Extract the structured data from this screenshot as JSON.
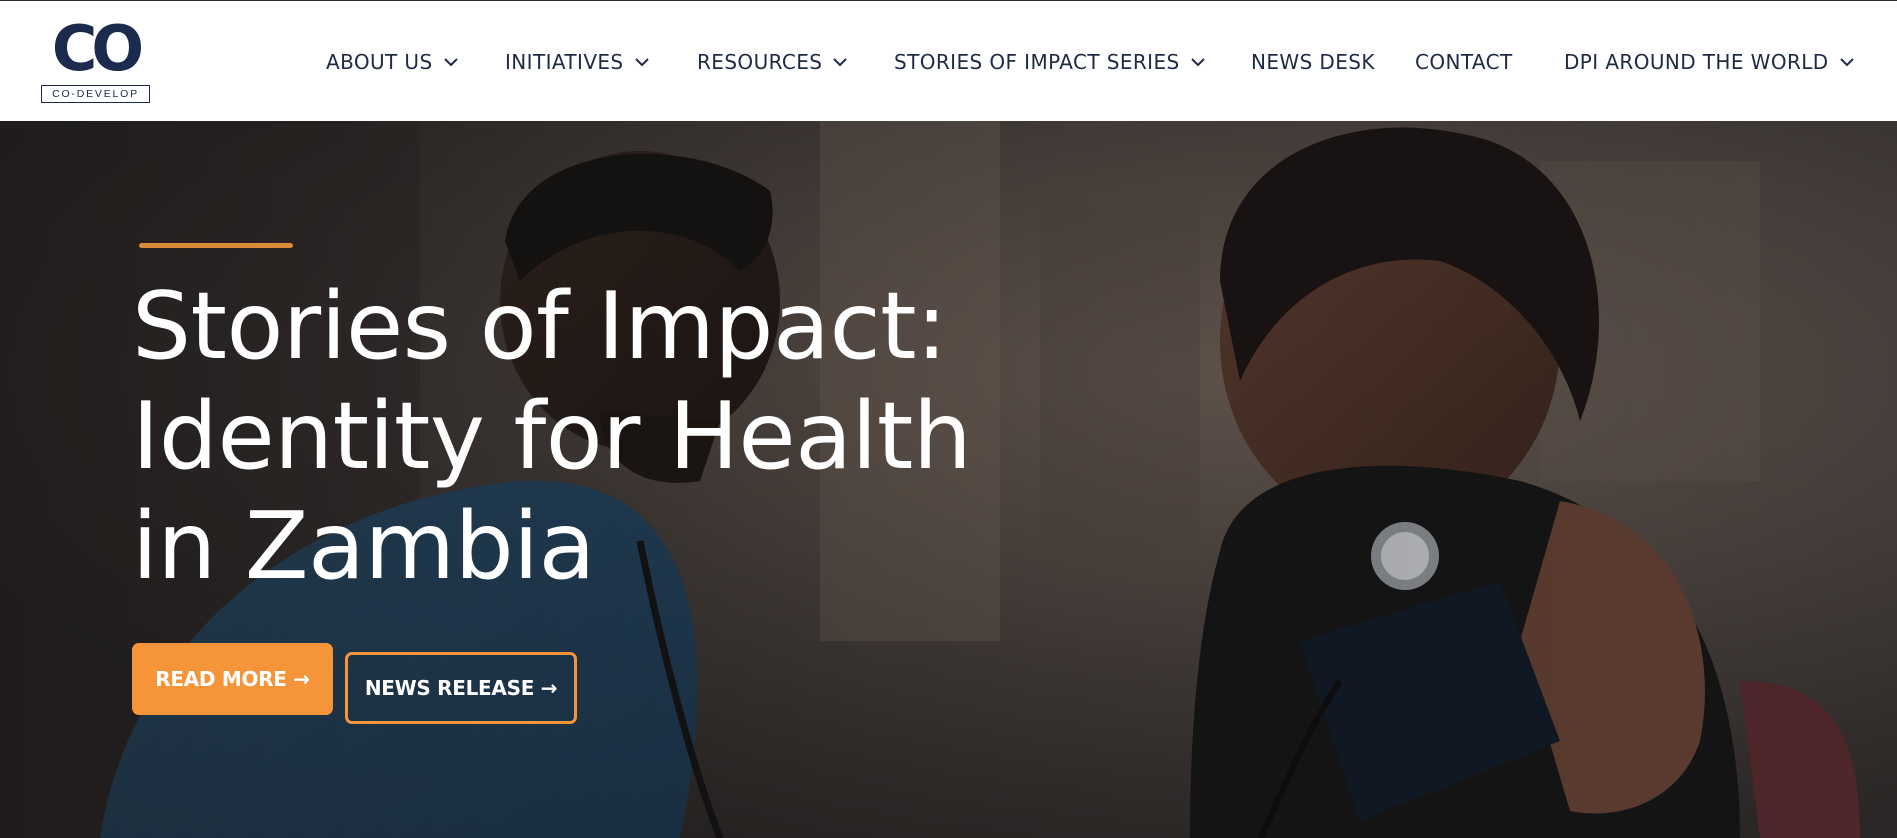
{
  "brand": {
    "logo_mark": "CO",
    "logo_word": "CO-DEVELOP",
    "primary_color": "#1c2a4d",
    "accent_color": "#f6943a"
  },
  "nav": {
    "about": {
      "label": "ABOUT US",
      "icon": "chevron-down-icon"
    },
    "initiatives": {
      "label": "INITIATIVES",
      "icon": "chevron-down-icon"
    },
    "resources": {
      "label": "RESOURCES",
      "icon": "chevron-down-icon"
    },
    "stories": {
      "label": "STORIES OF IMPACT SERIES",
      "icon": "chevron-down-icon"
    },
    "news": {
      "label": "NEWS DESK"
    },
    "contact": {
      "label": "CONTACT"
    },
    "dpi": {
      "label": "DPI AROUND THE WORLD",
      "icon": "chevron-down-icon"
    }
  },
  "hero": {
    "title_lines": [
      "Stories of Impact:",
      "Identity for Health",
      "in Zambia"
    ],
    "read_more_label": "READ MORE →",
    "news_release_label": "NEWS RELEASE →",
    "image_description_icon": "hero-photo"
  }
}
